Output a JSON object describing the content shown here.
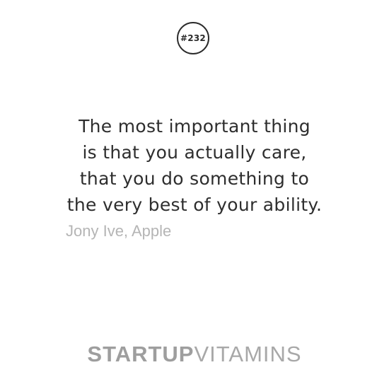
{
  "badge": {
    "number": "#232"
  },
  "quote": {
    "lines": [
      "The most important thing",
      "is that you actually care,",
      "that you do something to",
      "the very best of your ability."
    ]
  },
  "author": "Jony Ive, Apple",
  "brand": {
    "bold_part": "STARTUP",
    "light_part": "VITAMINS"
  }
}
